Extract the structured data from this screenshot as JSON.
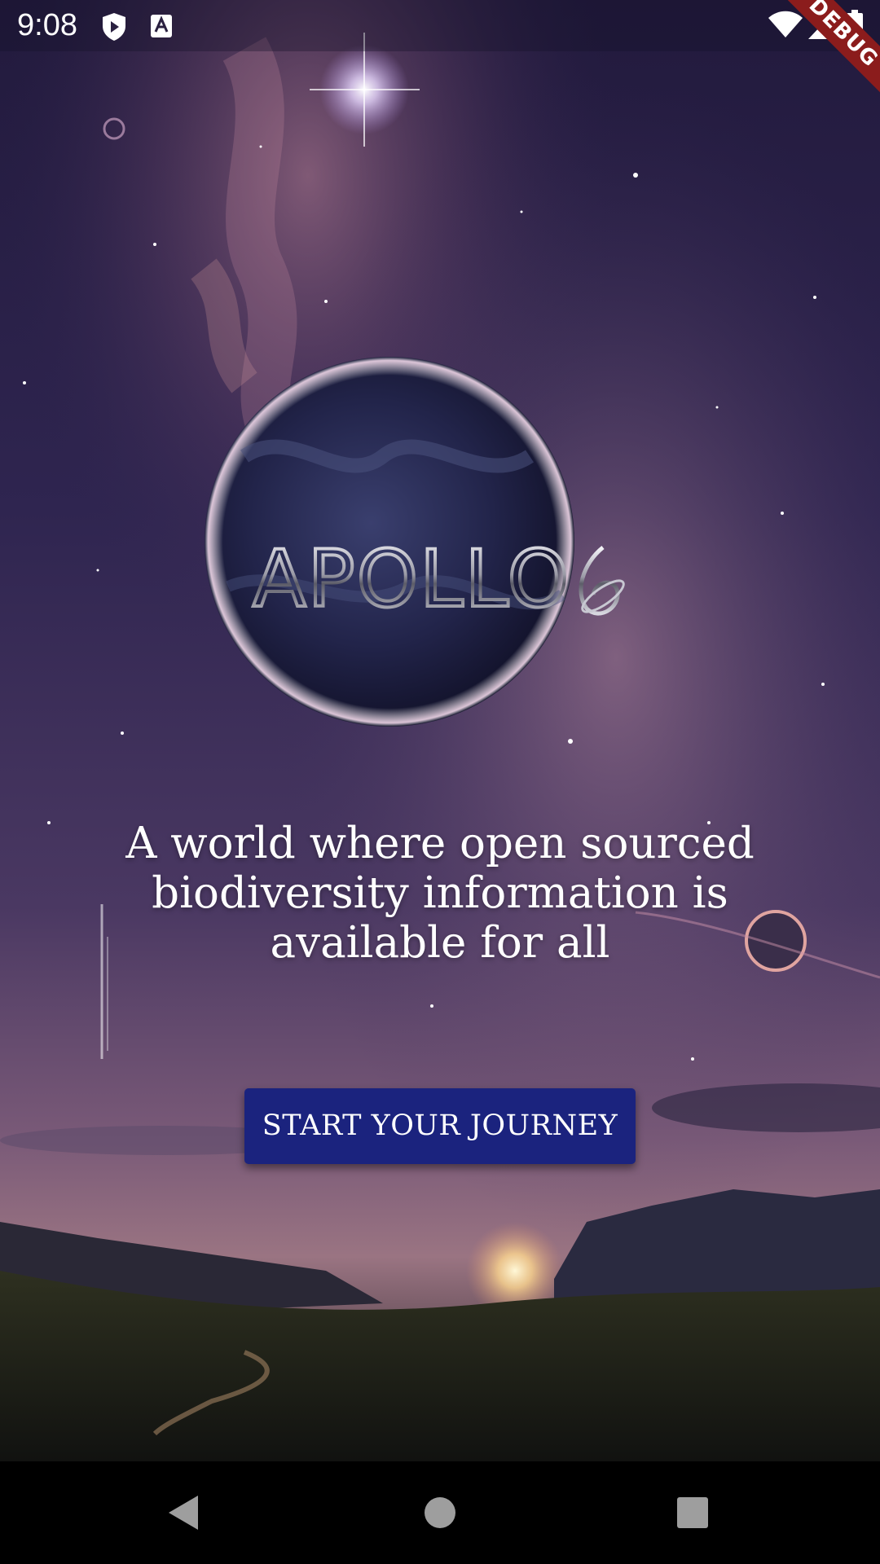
{
  "status_bar": {
    "time": "9:08",
    "icons": [
      "play-protect-icon",
      "accessibility-a-icon",
      "wifi-icon",
      "cell-signal-icon",
      "battery-icon"
    ]
  },
  "debug_banner": {
    "label": "DEBUG"
  },
  "logo": {
    "text": "APOLLO",
    "mark": "planet-ring-icon"
  },
  "tagline": {
    "lines": [
      "A world where open sourced",
      "biodiversity information is",
      "available for all"
    ]
  },
  "cta": {
    "label": "START YOUR JOURNEY",
    "color": "#1b237e"
  },
  "nav_bar": {
    "buttons": [
      "back-triangle-icon",
      "home-circle-icon",
      "recents-square-icon"
    ]
  },
  "colors": {
    "sky_top": "#2a2047",
    "sky_mid": "#3d2f5c",
    "glow": "#c98a9e",
    "button": "#1b237e",
    "banner": "#8b1c1c"
  }
}
